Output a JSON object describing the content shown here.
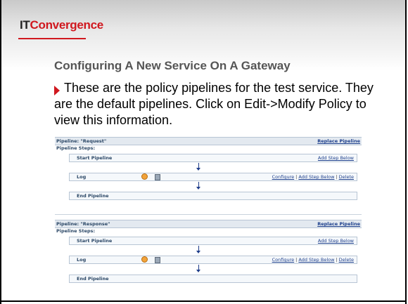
{
  "logo": {
    "it": "IT",
    "rest": "Convergence"
  },
  "title": "Configuring A New Service On A Gateway",
  "body": "These are the policy pipelines for the test service. They are the default pipelines. Click on Edit->Modify Policy to view this information.",
  "pipelines": [
    {
      "name": "Pipeline: \"Request\"",
      "replace": "Replace Pipeline",
      "steps_label": "Pipeline Steps:",
      "start": "Start Pipeline",
      "add_below": "Add Step Below",
      "log": "Log",
      "configure": "Configure",
      "add_step_below": "Add Step Below",
      "delete": "Delete",
      "end": "End Pipeline"
    },
    {
      "name": "Pipeline: \"Response\"",
      "replace": "Replace Pipeline",
      "steps_label": "Pipeline Steps:",
      "start": "Start Pipeline",
      "add_below": "Add Step Below",
      "log": "Log",
      "configure": "Configure",
      "add_step_below": "Add Step Below",
      "delete": "Delete",
      "end": "End Pipeline"
    }
  ],
  "colors": {
    "brand_red": "#d0181f",
    "link_blue": "#1d3f8c"
  },
  "icons": [
    "bullet-arrow-icon",
    "log-circle-icon",
    "log-doc-icon",
    "flow-down-arrow-icon"
  ]
}
